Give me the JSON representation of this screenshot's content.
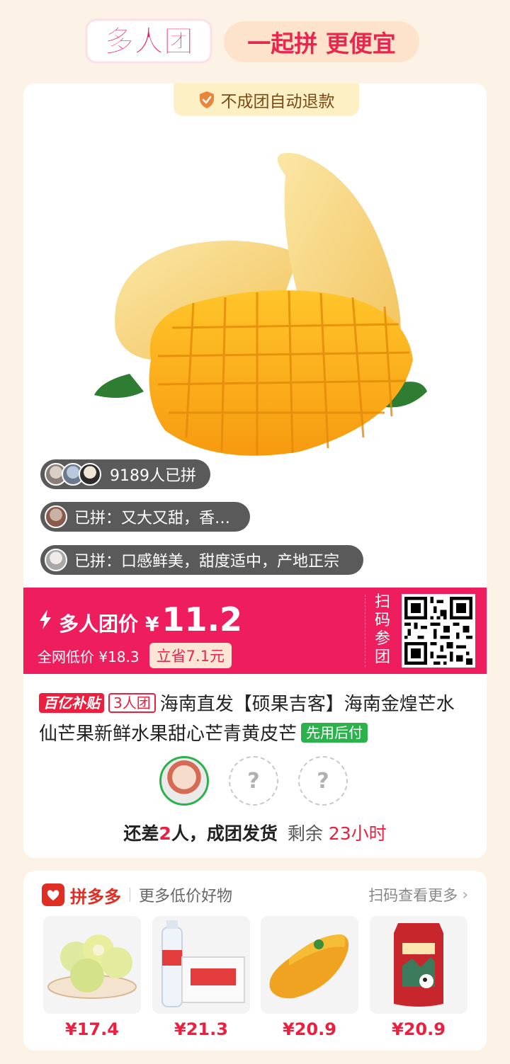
{
  "header": {
    "logo_text": "多人团",
    "slogan": "一起拼 更便宜"
  },
  "colors": {
    "brand_red": "#ee1e5e",
    "background": "#fdf2e6",
    "pdd_red": "#e02e24",
    "green": "#2bb24c"
  },
  "main": {
    "refund_tag": "不成团自动退款",
    "joined_count": "9189人已拼",
    "reviews": [
      "已拼：又大又甜，香…",
      "已拼：口感鲜美，甜度适中，产地正宗"
    ],
    "price": {
      "label": "多人团价",
      "currency": "¥",
      "value": "11.2",
      "market_label": "全网低价 ¥18.3",
      "save_label": "立省7.1元",
      "scan_label": "扫码参团"
    },
    "title": {
      "subsidy_tag": "百亿补贴",
      "group_tag": "3人团",
      "text": "海南直发【硕果吉客】海南金煌芒水仙芒果新鲜水果甜心芒青黄皮芒",
      "pay_tag": "先用后付"
    },
    "members": {
      "empty_symbol": "?"
    },
    "status": {
      "prefix": "还差",
      "count": "2",
      "suffix": "人，成团发货",
      "remaining_label": "剩余",
      "remaining_time": "23小时"
    }
  },
  "more": {
    "brand": "拼多多",
    "subtitle": "更多低价好物",
    "link": "扫码查看更多",
    "link_icon": "chevron-right-icon",
    "products": [
      {
        "icon": "guava-icon",
        "price": "¥17.4"
      },
      {
        "icon": "water-bottles-icon",
        "price": "¥21.3"
      },
      {
        "icon": "mango-icon",
        "price": "¥20.9"
      },
      {
        "icon": "rice-bag-icon",
        "price": "¥20.9"
      }
    ]
  }
}
